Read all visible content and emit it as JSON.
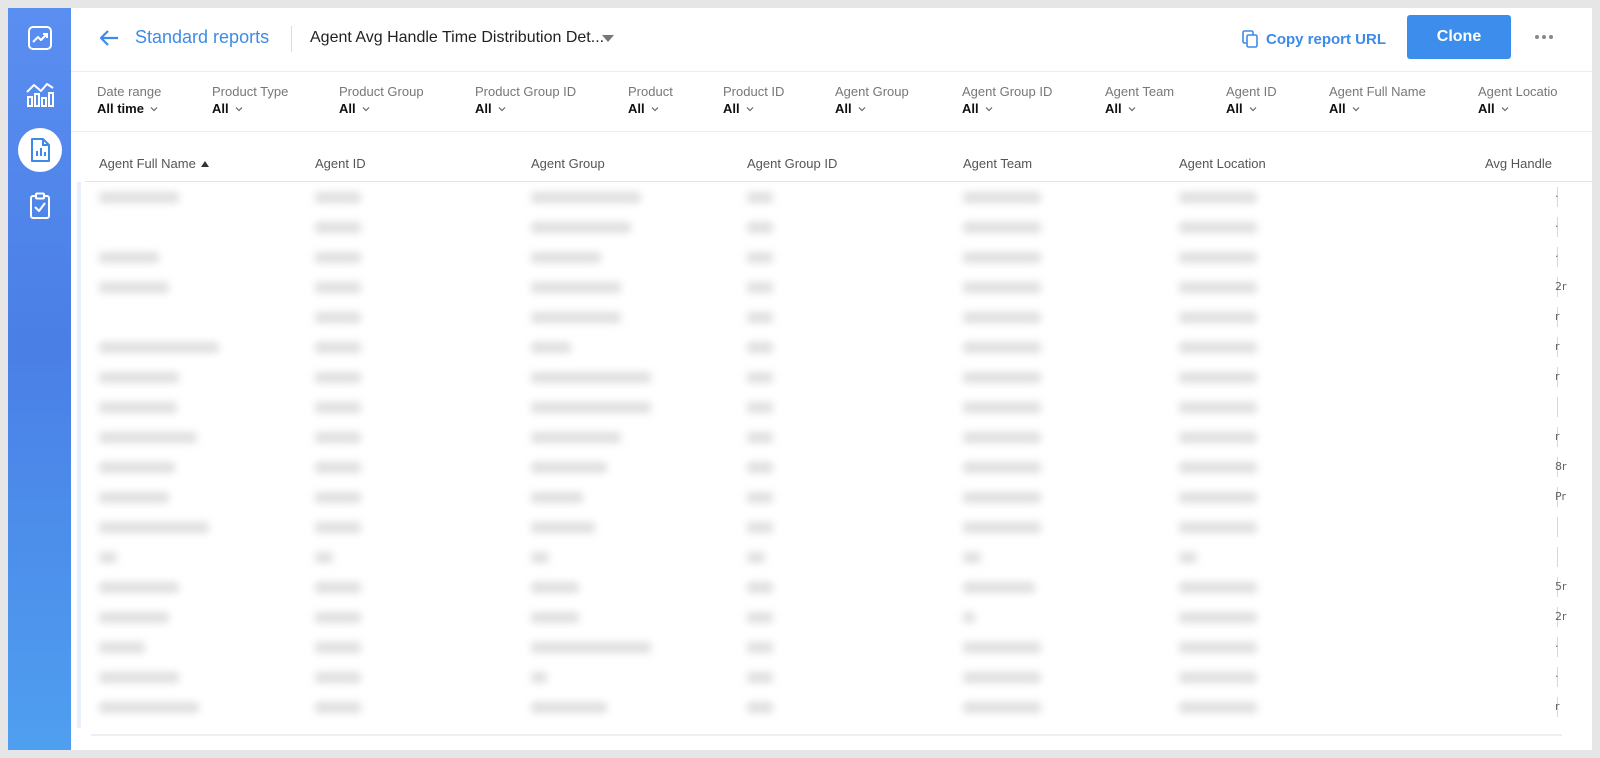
{
  "sidebar": {
    "items": [
      {
        "name": "trend-icon",
        "active": false
      },
      {
        "name": "analytics-icon",
        "active": false
      },
      {
        "name": "report-icon",
        "active": true
      },
      {
        "name": "clipboard-check-icon",
        "active": false
      }
    ]
  },
  "header": {
    "breadcrumb": "Standard reports",
    "report_title": "Agent Avg Handle Time Distribution Det...",
    "copy_url_label": "Copy report URL",
    "clone_label": "Clone"
  },
  "filters": [
    {
      "label": "Date range",
      "value": "All time"
    },
    {
      "label": "Product Type",
      "value": "All"
    },
    {
      "label": "Product Group",
      "value": "All"
    },
    {
      "label": "Product Group ID",
      "value": "All"
    },
    {
      "label": "Product",
      "value": "All"
    },
    {
      "label": "Product ID",
      "value": "All"
    },
    {
      "label": "Agent Group",
      "value": "All"
    },
    {
      "label": "Agent Group ID",
      "value": "All"
    },
    {
      "label": "Agent Team",
      "value": "All"
    },
    {
      "label": "Agent ID",
      "value": "All"
    },
    {
      "label": "Agent Full Name",
      "value": "All"
    },
    {
      "label": "Agent Locatio",
      "value": "All"
    }
  ],
  "table": {
    "columns": [
      "Agent Full Name",
      "Agent ID",
      "Agent Group",
      "Agent Group ID",
      "Agent Team",
      "Agent Location",
      "Avg Handle"
    ],
    "sorted_column": "Agent Full Name",
    "sort_direction": "ascending",
    "row_count_visible": 18,
    "right_edge_chars": [
      "·",
      "·",
      "·",
      "2r",
      "r",
      "r",
      "r",
      "",
      "r",
      "8r",
      "Pr",
      "",
      "",
      "5r",
      "2r",
      "·",
      "·",
      "r"
    ]
  },
  "colors": {
    "accent": "#3d8be8",
    "button": "#3d8eec",
    "sidebar_top": "#5a8ef0",
    "sidebar_bottom": "#4f9ff0"
  }
}
